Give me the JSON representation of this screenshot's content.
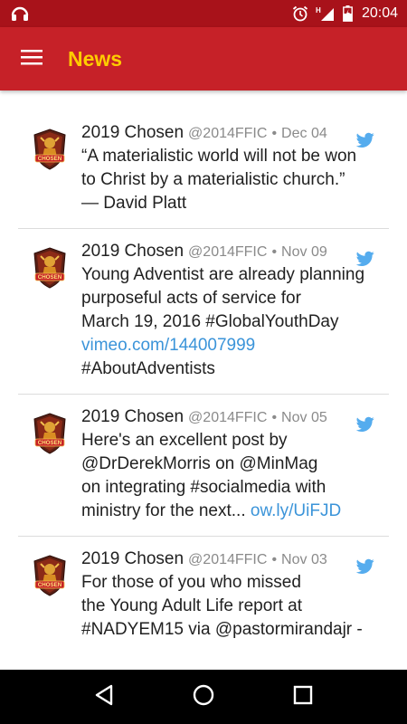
{
  "status_bar": {
    "time": "20:04",
    "network_indicator": "H",
    "icons": [
      "headphones-icon",
      "alarm-icon",
      "signal-icon",
      "battery-icon"
    ]
  },
  "app_bar": {
    "title": "News",
    "menu_icon": "hamburger-menu-icon",
    "background_color": "#c62128",
    "title_color": "#ffcc00"
  },
  "tweets": [
    {
      "name": "2019 Chosen",
      "handle": "@2014FFIC",
      "separator": "•",
      "date": "Dec 04",
      "lines": [
        {
          "text": "“A materialistic world will not be won",
          "link": false
        },
        {
          "text": "to Christ by a materialistic church.”",
          "link": false
        },
        {
          "text": "— David Platt",
          "link": false
        }
      ]
    },
    {
      "name": "2019 Chosen",
      "handle": "@2014FFIC",
      "separator": "•",
      "date": "Nov 09",
      "lines": [
        {
          "text": "Young Adventist are already planning",
          "link": false
        },
        {
          "text": "purposeful acts of service for",
          "link": false
        },
        {
          "text": "March 19, 2016 #GlobalYouthDay",
          "link": false
        },
        {
          "text": "vimeo.com/144007999",
          "link": true
        },
        {
          "text": "#AboutAdventists",
          "link": false
        }
      ]
    },
    {
      "name": "2019 Chosen",
      "handle": "@2014FFIC",
      "separator": "•",
      "date": "Nov 05",
      "lines": [
        {
          "text": "Here's an excellent post by",
          "link": false
        },
        {
          "text": "@DrDerekMorris on @MinMag",
          "link": false
        },
        {
          "text": "on integrating #socialmedia with",
          "link": false
        },
        {
          "text": "ministry for the next... ",
          "link": false,
          "suffix": "ow.ly/UiFJD"
        }
      ]
    },
    {
      "name": "2019 Chosen",
      "handle": "@2014FFIC",
      "separator": "•",
      "date": "Nov 03",
      "lines": [
        {
          "text": "For those of you who missed",
          "link": false
        },
        {
          "text": "the Young Adult Life report at",
          "link": false
        },
        {
          "text": "#NADYEM15 via @pastormirandajr -",
          "link": false
        }
      ]
    }
  ],
  "nav_bar": {
    "buttons": [
      "back-icon",
      "home-icon",
      "recents-icon"
    ]
  },
  "colors": {
    "status_bar": "#a8121a",
    "link": "#3b94d9",
    "twitter_bird": "#55acee",
    "meta_text": "#8a8a8a"
  }
}
